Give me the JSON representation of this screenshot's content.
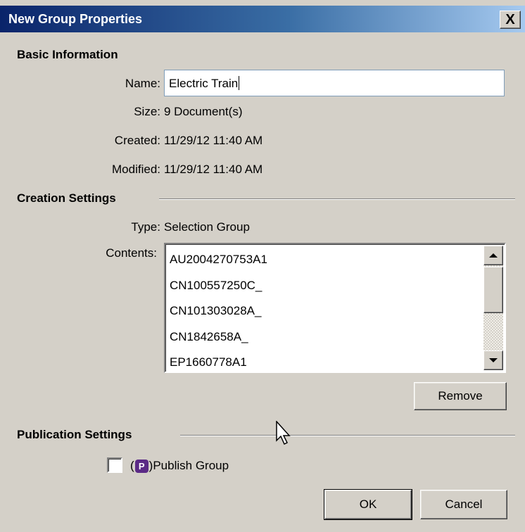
{
  "window": {
    "title": "New Group Properties",
    "close_label": "X"
  },
  "basic": {
    "section_title": "Basic Information",
    "name_label": "Name:",
    "name_value": "Electric Train",
    "size_label": "Size:",
    "size_value": "9 Document(s)",
    "created_label": "Created:",
    "created_value": "11/29/12 11:40 AM",
    "modified_label": "Modified:",
    "modified_value": "11/29/12 11:40 AM"
  },
  "creation": {
    "section_title": "Creation Settings",
    "type_label": "Type:",
    "type_value": "Selection Group",
    "contents_label": "Contents:",
    "contents": [
      "AU2004270753A1",
      "CN100557250C_",
      "CN101303028A_",
      "CN1842658A_",
      "EP1660778A1"
    ],
    "remove_label": "Remove"
  },
  "publication": {
    "section_title": "Publication Settings",
    "publish_prefix": "(",
    "publish_badge": "P",
    "publish_suffix": ")Publish Group",
    "publish_checked": false
  },
  "footer": {
    "ok_label": "OK",
    "cancel_label": "Cancel"
  }
}
